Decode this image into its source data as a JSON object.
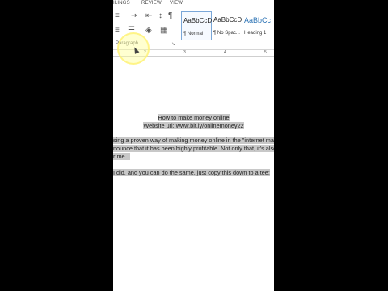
{
  "ribbon": {
    "tabs": [
      "ILINGS",
      "REVIEW",
      "VIEW"
    ],
    "paragraph_group_label": "Paragraph",
    "paragraph_controls": {
      "sort": "↕",
      "show_marks": "¶"
    },
    "styles": [
      {
        "sample": "AaBbCcDc",
        "name": "¶ Normal",
        "selected": true
      },
      {
        "sample": "AaBbCcDc",
        "name": "¶ No Spac...",
        "selected": false
      },
      {
        "sample": "AaBbCc",
        "name": "Heading 1",
        "selected": false
      }
    ]
  },
  "ruler": {
    "marks": [
      "2",
      "3",
      "4",
      "5"
    ]
  },
  "document": {
    "lines": [
      "How to make money online",
      "Website url: www.bit.ly/onlinemoney22",
      "sing a proven way of making money online in the \"internet mark",
      "nounce that it has been highly profitable. Not only that, it's also",
      "r me...",
      "I did, and you can do the same, just copy this down to a tee:"
    ]
  },
  "colors": {
    "highlight": "#c8c8c8",
    "spotlight": "#ffff96"
  }
}
